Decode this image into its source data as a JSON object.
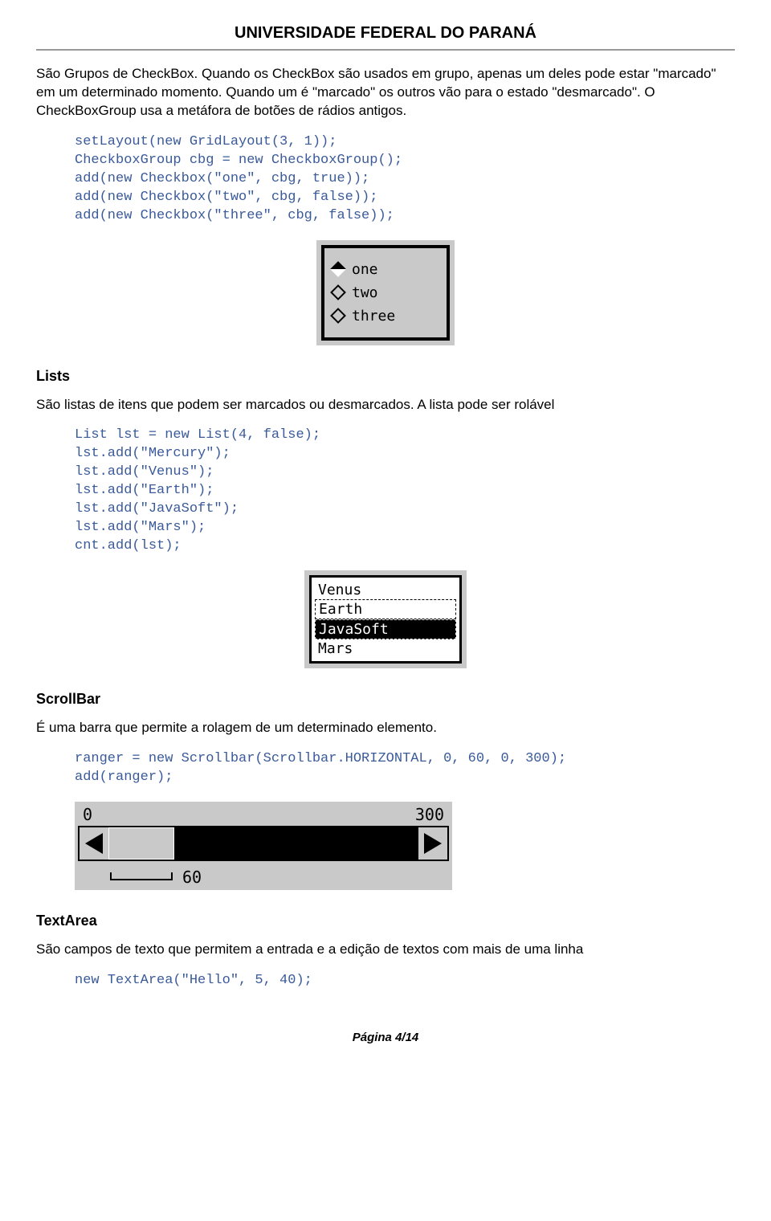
{
  "header": {
    "title": "UNIVERSIDADE FEDERAL DO PARANÁ"
  },
  "intro": {
    "paragraph": "São Grupos de CheckBox. Quando os CheckBox são usados em grupo, apenas um deles pode estar \"marcado\" em um determinado momento. Quando um é \"marcado\" os outros vão para o estado \"desmarcado\". O CheckBoxGroup usa a metáfora de botões de rádios antigos."
  },
  "code1": "setLayout(new GridLayout(3, 1));\nCheckboxGroup cbg = new CheckboxGroup();\nadd(new Checkbox(\"one\", cbg, true));\nadd(new Checkbox(\"two\", cbg, false));\nadd(new Checkbox(\"three\", cbg, false));",
  "radio_figure": {
    "items": [
      "one",
      "two",
      "three"
    ]
  },
  "lists": {
    "heading": "Lists",
    "paragraph": "São listas de itens que podem ser marcados ou desmarcados. A lista pode ser rolável",
    "code": "List lst = new List(4, false);\nlst.add(\"Mercury\");\nlst.add(\"Venus\");\nlst.add(\"Earth\");\nlst.add(\"JavaSoft\");\nlst.add(\"Mars\");\ncnt.add(lst);",
    "items": [
      "Venus",
      "Earth",
      "JavaSoft",
      "Mars"
    ]
  },
  "scrollbar": {
    "heading": "ScrollBar",
    "paragraph": "É uma barra que permite a rolagem de um determinado elemento.",
    "code": "ranger = new Scrollbar(Scrollbar.HORIZONTAL, 0, 60, 0, 300);\nadd(ranger);",
    "label_min": "0",
    "label_max": "300",
    "label_thumb": "60"
  },
  "textarea": {
    "heading": "TextArea",
    "paragraph": "São campos de texto que permitem a entrada e a edição de textos com mais de uma linha",
    "code": "new TextArea(\"Hello\", 5, 40);"
  },
  "footer": {
    "page": "Página 4/14"
  }
}
